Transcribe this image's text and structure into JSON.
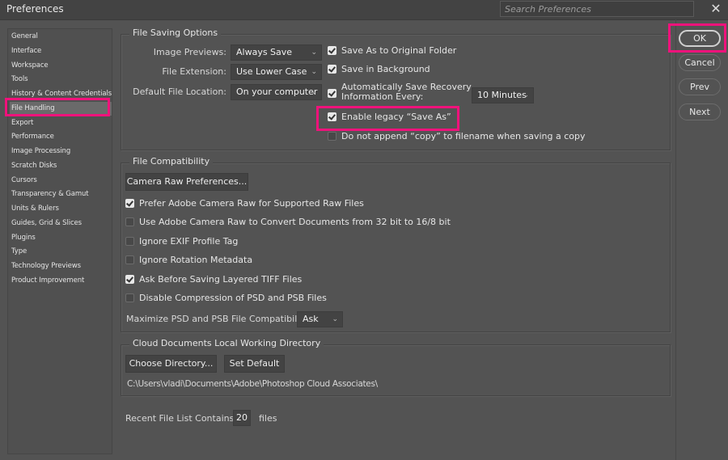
{
  "window": {
    "title": "Preferences",
    "search_placeholder": "Search Preferences",
    "close_icon": "close-icon"
  },
  "sidebar": {
    "items": [
      {
        "label": "General"
      },
      {
        "label": "Interface"
      },
      {
        "label": "Workspace"
      },
      {
        "label": "Tools"
      },
      {
        "label": "History & Content Credentials"
      },
      {
        "label": "File Handling",
        "selected": true
      },
      {
        "label": "Export"
      },
      {
        "label": "Performance"
      },
      {
        "label": "Image Processing"
      },
      {
        "label": "Scratch Disks"
      },
      {
        "label": "Cursors"
      },
      {
        "label": "Transparency & Gamut"
      },
      {
        "label": "Units & Rulers"
      },
      {
        "label": "Guides, Grid & Slices"
      },
      {
        "label": "Plugins"
      },
      {
        "label": "Type"
      },
      {
        "label": "Technology Previews"
      },
      {
        "label": "Product Improvement"
      }
    ]
  },
  "file_saving": {
    "title": "File Saving Options",
    "image_previews": {
      "label": "Image Previews:",
      "value": "Always Save"
    },
    "file_extension": {
      "label": "File Extension:",
      "value": "Use Lower Case"
    },
    "default_location": {
      "label": "Default File Location:",
      "value": "On your computer"
    },
    "save_as_original": {
      "label": "Save As to Original Folder",
      "checked": true
    },
    "save_background": {
      "label": "Save in Background",
      "checked": true
    },
    "auto_save": {
      "label_line1": "Automatically Save Recovery",
      "label_line2": "Information Every:",
      "checked": true,
      "interval": "10 Minutes"
    },
    "legacy_save_as": {
      "label": "Enable legacy “Save As”",
      "checked": true
    },
    "no_copy": {
      "label": "Do not append “copy” to filename when saving a copy",
      "checked": false
    }
  },
  "file_compat": {
    "title": "File Compatibility",
    "camera_raw_button": "Camera Raw Preferences...",
    "options": [
      {
        "label": "Prefer Adobe Camera Raw for Supported Raw Files",
        "checked": true
      },
      {
        "label": "Use Adobe Camera Raw to Convert Documents from 32 bit to 16/8 bit",
        "checked": false
      },
      {
        "label": "Ignore EXIF Profile Tag",
        "checked": false
      },
      {
        "label": "Ignore Rotation Metadata",
        "checked": false
      },
      {
        "label": "Ask Before Saving Layered TIFF Files",
        "checked": true
      },
      {
        "label": "Disable Compression of PSD and PSB Files",
        "checked": false
      }
    ],
    "maximize": {
      "label": "Maximize PSD and PSB File Compatibility:",
      "value": "Ask"
    }
  },
  "cloud_docs": {
    "title": "Cloud Documents Local Working Directory",
    "choose_button": "Choose Directory...",
    "default_button": "Set Default",
    "path": "C:\\Users\\vladi\\Documents\\Adobe\\Photoshop Cloud Associates\\"
  },
  "recent_files": {
    "label": "Recent File List Contains:",
    "value": "20",
    "suffix": "files"
  },
  "actions": {
    "ok": "OK",
    "cancel": "Cancel",
    "prev": "Prev",
    "next": "Next"
  },
  "colors": {
    "highlight": "#f0127b",
    "background": "#535353"
  }
}
